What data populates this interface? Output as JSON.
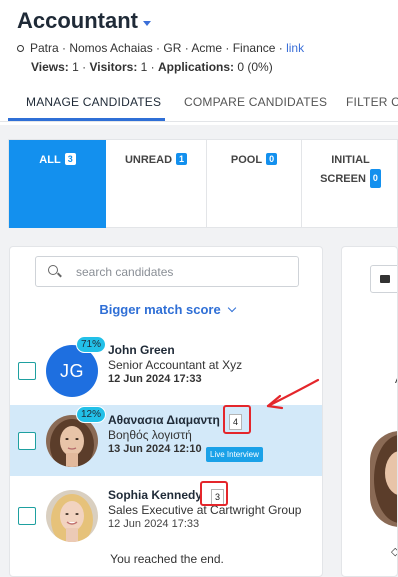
{
  "job": {
    "title": "Accountant",
    "meta": "Patra · Nomos Achaias · GR · Acme · Finance ·",
    "meta_link": "link",
    "views_label": "Views:",
    "views_value": "1",
    "visitors_label": "Visitors:",
    "visitors_value": "1",
    "applications_label": "Applications:",
    "applications_value": "0 (0%)"
  },
  "tabs": [
    {
      "label": "MANAGE CANDIDATES",
      "active": true
    },
    {
      "label": "COMPARE CANDIDATES",
      "active": false
    },
    {
      "label": "FILTER CA",
      "active": false
    }
  ],
  "filters": [
    {
      "label": "ALL",
      "count": "3",
      "active": true
    },
    {
      "label": "UNREAD",
      "count": "1",
      "active": false
    },
    {
      "label": "POOL",
      "count": "0",
      "active": false
    },
    {
      "label_line1": "INITIAL",
      "label_line2": "SCREEN",
      "count": "0",
      "active": false
    }
  ],
  "search": {
    "placeholder": "search candidates"
  },
  "sort": {
    "label": "Bigger match score"
  },
  "candidates": [
    {
      "initials": "JG",
      "score": "71%",
      "name": "John Green",
      "role": "Senior Accountant at Xyz",
      "date": "12 Jun 2024 17:33"
    },
    {
      "score": "12%",
      "name": "Αθανασια Διαμαντη",
      "count": "4",
      "role": "Βοηθός λογιστή",
      "date": "13 Jun 2024 12:10",
      "tag": "Live Interview",
      "selected": true
    },
    {
      "name": "Sophia Kennedy",
      "count": "3",
      "role": "Sales Executive at Cartwright Group",
      "date": "12 Jun 2024 17:33"
    }
  ],
  "end_text": "You reached the end.",
  "right_panel": {
    "letter": "A",
    "mark": "◇"
  },
  "colors": {
    "accent": "#1390ee",
    "annotation": "#e4262b",
    "selected_row": "#d3e9f9",
    "score_badge": "#22c0e8"
  }
}
